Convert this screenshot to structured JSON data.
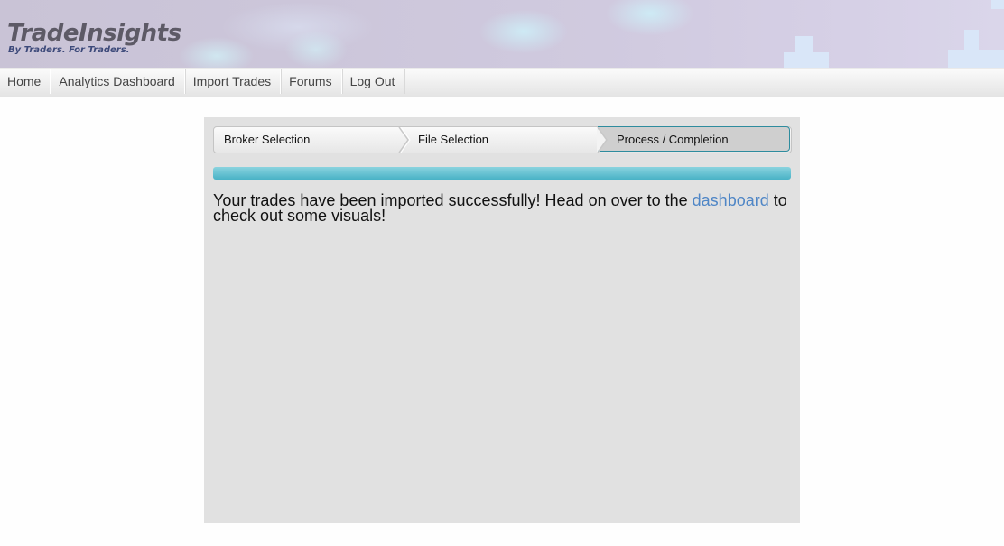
{
  "header": {
    "logo_title": "TradeInsights",
    "logo_tagline": "By Traders. For Traders."
  },
  "nav": {
    "items": [
      {
        "label": "Home"
      },
      {
        "label": "Analytics Dashboard"
      },
      {
        "label": "Import Trades"
      },
      {
        "label": "Forums"
      },
      {
        "label": "Log Out"
      }
    ]
  },
  "wizard": {
    "steps": [
      {
        "label": "Broker Selection",
        "state": "completed"
      },
      {
        "label": "File Selection",
        "state": "completed"
      },
      {
        "label": "Process / Completion",
        "state": "active"
      }
    ],
    "progress_percent": 100,
    "colors": {
      "progress": "#49b2c6",
      "active_border": "#2e8c9e",
      "link": "#4f86c6"
    }
  },
  "message": {
    "before_link": "Your trades have been imported successfully! Head on over to the ",
    "link_text": "dashboard",
    "after_link": " to check out some visuals!"
  }
}
